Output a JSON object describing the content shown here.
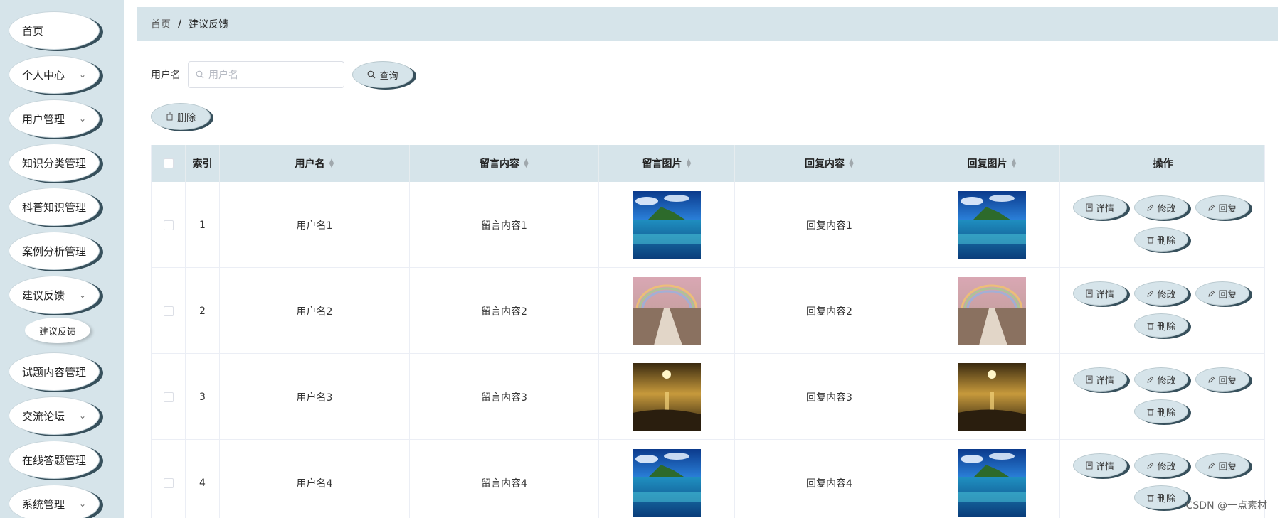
{
  "sidebar": {
    "items": [
      {
        "label": "首页",
        "chevron": false
      },
      {
        "label": "个人中心",
        "chevron": true
      },
      {
        "label": "用户管理",
        "chevron": true
      },
      {
        "label": "知识分类管理",
        "chevron": false
      },
      {
        "label": "科普知识管理",
        "chevron": false
      },
      {
        "label": "案例分析管理",
        "chevron": false
      },
      {
        "label": "建议反馈",
        "chevron": true
      },
      {
        "label": "试题内容管理",
        "chevron": false
      },
      {
        "label": "交流论坛",
        "chevron": true
      },
      {
        "label": "在线答题管理",
        "chevron": false
      },
      {
        "label": "系统管理",
        "chevron": true
      }
    ],
    "submenu": {
      "label": "建议反馈"
    },
    "chevron_glyph": "⌄"
  },
  "breadcrumb": {
    "home": "首页",
    "separator": "/",
    "current": "建议反馈"
  },
  "search": {
    "label": "用户名",
    "placeholder": "用户名",
    "button_label": "查询"
  },
  "toolbar": {
    "delete_label": "删除"
  },
  "table": {
    "headers": {
      "index": "索引",
      "username": "用户名",
      "message": "留言内容",
      "message_image": "留言图片",
      "reply": "回复内容",
      "reply_image": "回复图片",
      "actions": "操作"
    },
    "rows": [
      {
        "index": "1",
        "username": "用户名1",
        "message": "留言内容1",
        "reply": "回复内容1",
        "image": "island-lagoon"
      },
      {
        "index": "2",
        "username": "用户名2",
        "message": "留言内容2",
        "reply": "回复内容2",
        "image": "rainbow-path"
      },
      {
        "index": "3",
        "username": "用户名3",
        "message": "留言内容3",
        "reply": "回复内容3",
        "image": "sunset-beach"
      },
      {
        "index": "4",
        "username": "用户名4",
        "message": "留言内容4",
        "reply": "回复内容4",
        "image": "island-lagoon"
      }
    ],
    "row_actions": {
      "detail": "详情",
      "edit": "修改",
      "reply": "回复",
      "delete": "删除"
    }
  },
  "watermark": "CSDN @一点素材",
  "colors": {
    "accent": "#d6e4ea",
    "shadow": "#37505c"
  }
}
